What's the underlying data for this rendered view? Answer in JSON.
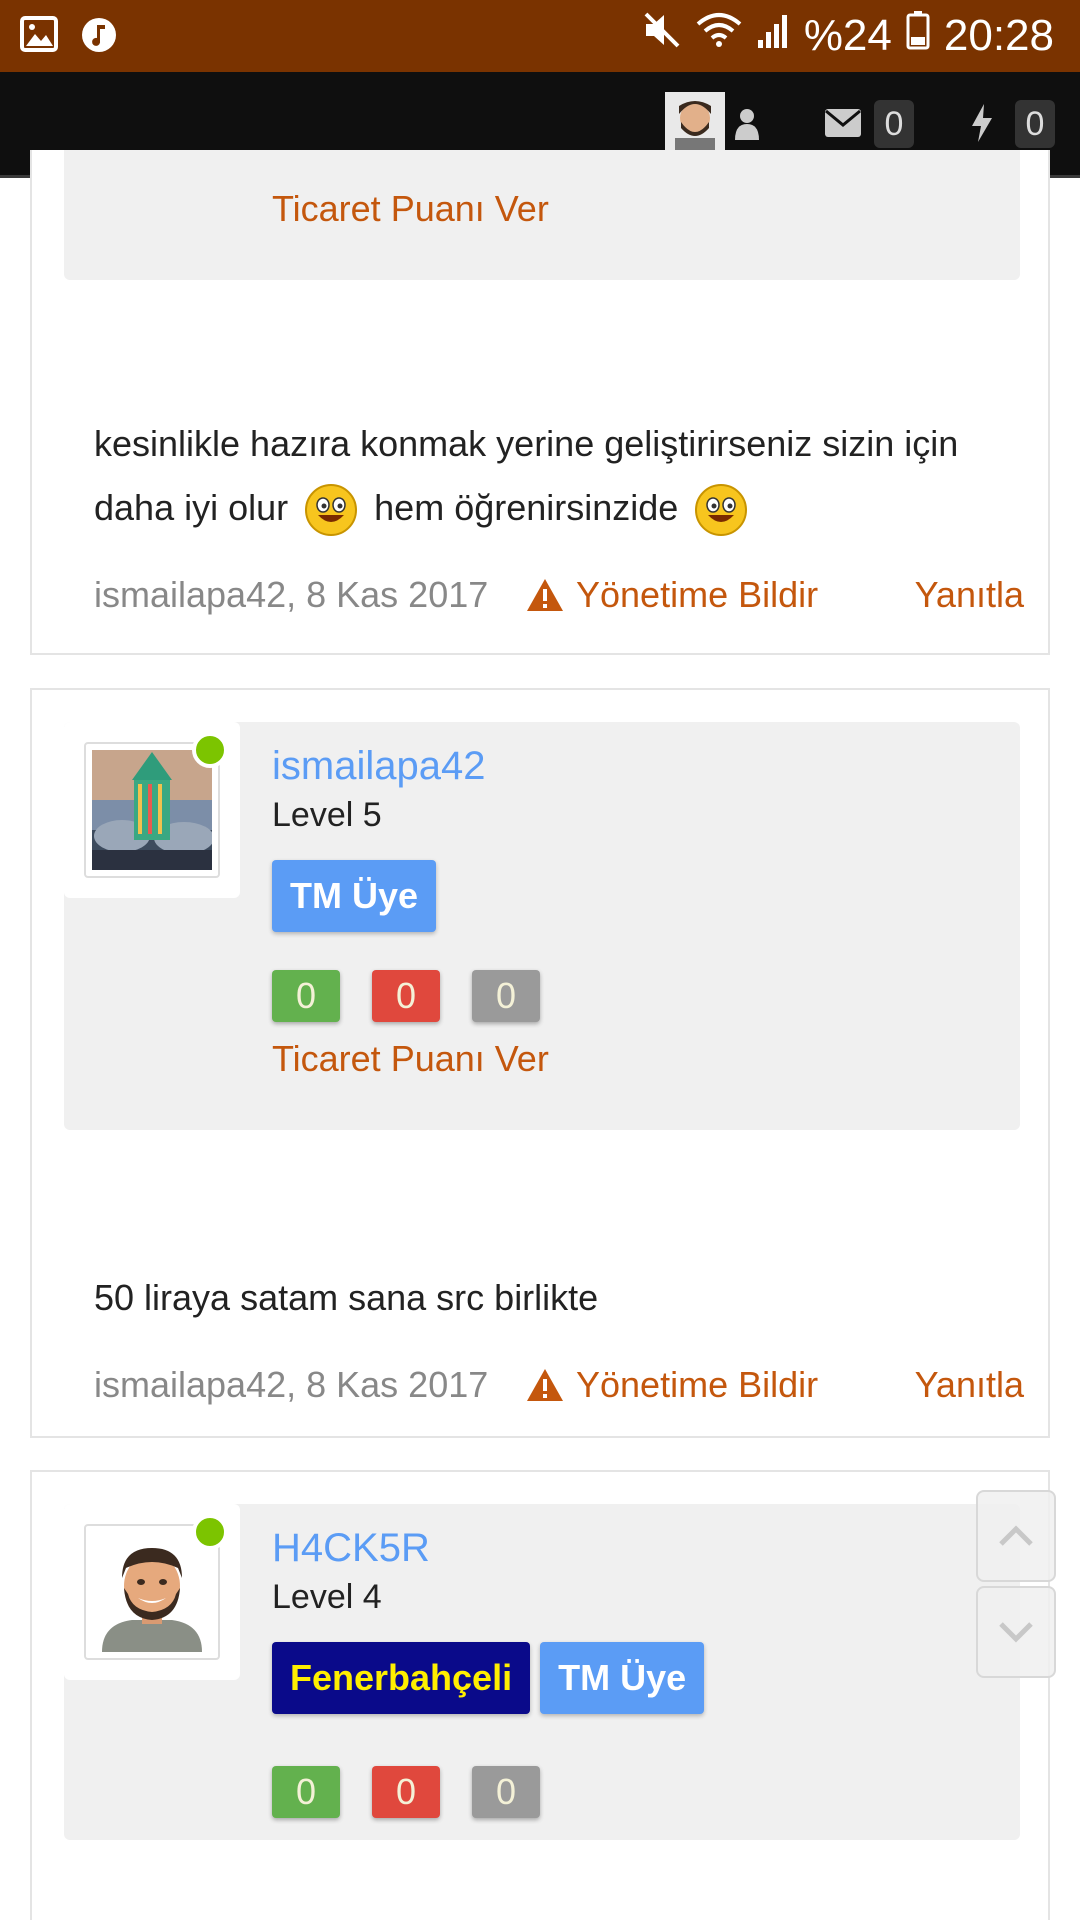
{
  "status_bar": {
    "battery": "%24",
    "time": "20:28",
    "icons": [
      "gallery-icon",
      "music-icon",
      "mute-icon",
      "wifi-icon",
      "signal-icon",
      "battery-icon"
    ]
  },
  "nav": {
    "messages_count": "0",
    "alerts_count": "0"
  },
  "posts": [
    {
      "trade_link": "Ticaret Puanı Ver",
      "message_part1": "kesinlikle hazıra konmak yerine geliştirirseniz sizin için daha iyi olur",
      "message_part2": "hem öğrenirsinzide",
      "meta": {
        "author_date": "ismailapa42, 8 Kas 2017",
        "report": "Yönetime Bildir",
        "reply": "Yanıtla"
      }
    },
    {
      "username": "ismailapa42",
      "level": "Level 5",
      "badges": [
        "TM Üye"
      ],
      "trade": [
        "0",
        "0",
        "0"
      ],
      "trade_link": "Ticaret Puanı Ver",
      "message": "50 liraya satam sana src birlikte",
      "meta": {
        "author_date": "ismailapa42, 8 Kas 2017",
        "report": "Yönetime Bildir",
        "reply": "Yanıtla"
      }
    },
    {
      "username": "H4CK5R",
      "level": "Level 4",
      "badges": [
        "Fenerbahçeli",
        "TM Üye"
      ],
      "trade": [
        "0",
        "0",
        "0"
      ]
    }
  ],
  "colors": {
    "status_bar": "#7a3300",
    "nav_bar": "#0f0f0f",
    "link": "#c4570d",
    "username": "#5b9cf5",
    "online": "#7cc400"
  }
}
